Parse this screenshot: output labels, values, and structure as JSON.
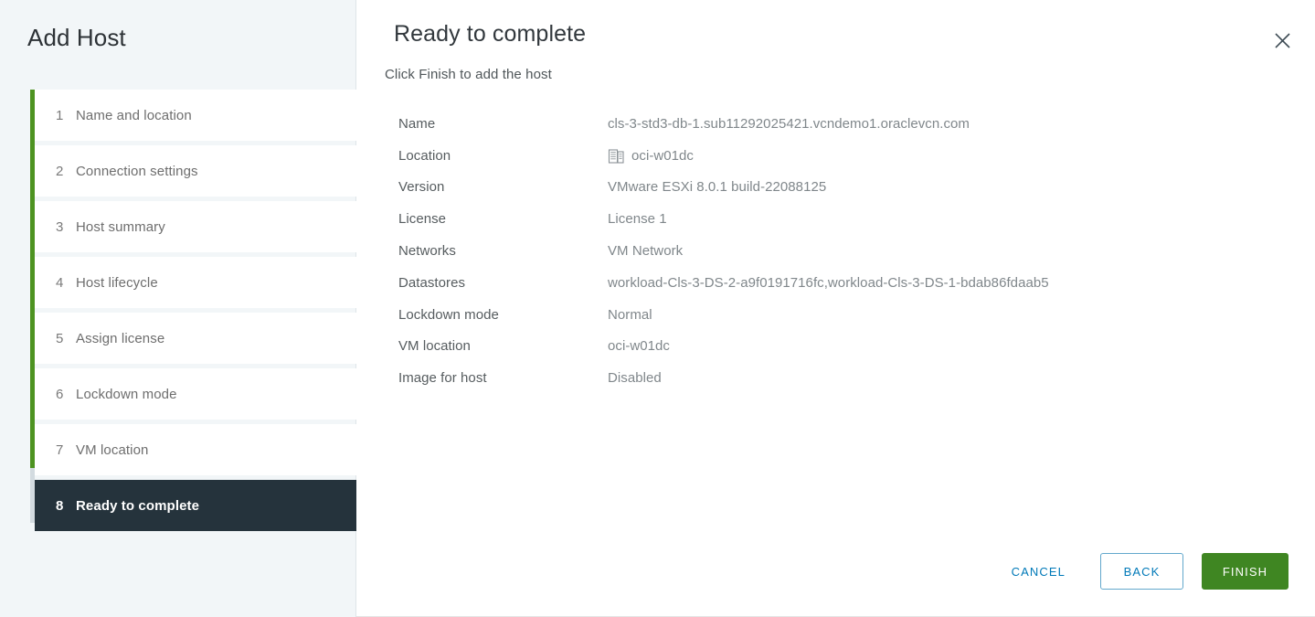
{
  "wizard": {
    "title": "Add Host",
    "close_icon": "close-icon",
    "steps": [
      {
        "number": "1",
        "label": "Name and location",
        "active": false
      },
      {
        "number": "2",
        "label": "Connection settings",
        "active": false
      },
      {
        "number": "3",
        "label": "Host summary",
        "active": false
      },
      {
        "number": "4",
        "label": "Host lifecycle",
        "active": false
      },
      {
        "number": "5",
        "label": "Assign license",
        "active": false
      },
      {
        "number": "6",
        "label": "Lockdown mode",
        "active": false
      },
      {
        "number": "7",
        "label": "VM location",
        "active": false
      },
      {
        "number": "8",
        "label": "Ready to complete",
        "active": true
      }
    ]
  },
  "page": {
    "title": "Ready to complete",
    "subtitle": "Click Finish to add the host"
  },
  "summary": {
    "rows": [
      {
        "label": "Name",
        "value": "cls-3-std3-db-1.sub11292025421.vcndemo1.oraclevcn.com",
        "icon": ""
      },
      {
        "label": "Location",
        "value": "oci-w01dc",
        "icon": "datacenter-icon"
      },
      {
        "label": "Version",
        "value": "VMware ESXi 8.0.1 build-22088125",
        "icon": ""
      },
      {
        "label": "License",
        "value": "License 1",
        "icon": ""
      },
      {
        "label": "Networks",
        "value": "VM Network",
        "icon": ""
      },
      {
        "label": "Datastores",
        "value": "workload-Cls-3-DS-2-a9f0191716fc,workload-Cls-3-DS-1-bdab86fdaab5",
        "icon": ""
      },
      {
        "label": "Lockdown mode",
        "value": "Normal",
        "icon": ""
      },
      {
        "label": "VM location",
        "value": "oci-w01dc",
        "icon": ""
      },
      {
        "label": "Image for host",
        "value": "Disabled",
        "icon": ""
      }
    ]
  },
  "footer": {
    "cancel_label": "CANCEL",
    "back_label": "BACK",
    "finish_label": "FINISH"
  },
  "colors": {
    "accent_green": "#4d9321",
    "finish_green": "#3f8622",
    "link_blue": "#0079b8",
    "active_step_bg": "#25333c",
    "sidebar_bg": "#f2f6f8"
  }
}
